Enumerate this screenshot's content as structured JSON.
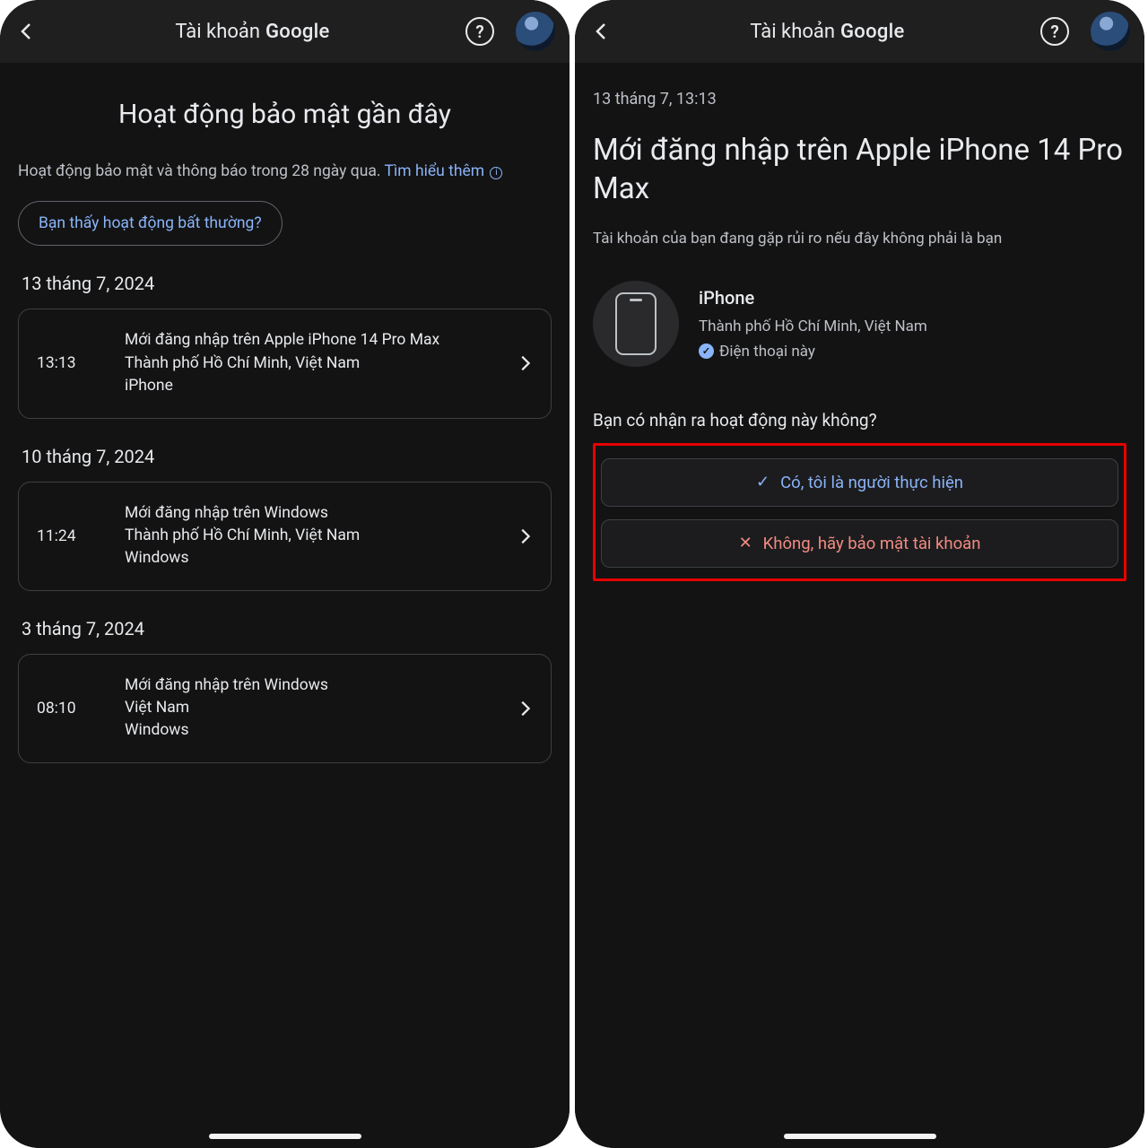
{
  "header": {
    "title_prefix": "Tài khoản",
    "brand": "Google",
    "help_glyph": "?"
  },
  "left": {
    "page_title": "Hoạt động bảo mật gần đây",
    "intro_text": "Hoạt động bảo mật và thông báo trong 28 ngày qua. ",
    "learn_more": "Tìm hiểu thêm",
    "unusual_btn": "Bạn thấy hoạt động bất thường?",
    "groups": [
      {
        "date": "13 tháng 7, 2024",
        "item": {
          "time": "13:13",
          "line1": "Mới đăng nhập trên Apple iPhone 14 Pro Max",
          "line2": "Thành phố Hồ Chí Minh, Việt Nam",
          "line3": "iPhone"
        }
      },
      {
        "date": "10 tháng 7, 2024",
        "item": {
          "time": "11:24",
          "line1": "Mới đăng nhập trên Windows",
          "line2": "Thành phố Hồ Chí Minh, Việt Nam",
          "line3": "Windows"
        }
      },
      {
        "date": "3 tháng 7, 2024",
        "item": {
          "time": "08:10",
          "line1": "Mới đăng nhập trên Windows",
          "line2": "Việt Nam",
          "line3": "Windows"
        }
      }
    ]
  },
  "right": {
    "timestamp": "13 tháng 7, 13:13",
    "title": "Mới đăng nhập trên Apple iPhone 14 Pro Max",
    "warning": "Tài khoản của bạn đang gặp rủi ro nếu đây không phải là bạn",
    "device": {
      "name": "iPhone",
      "location": "Thành phố Hồ Chí Minh, Việt Nam",
      "this_device": "Điện thoại này"
    },
    "prompt": "Bạn có nhận ra hoạt động này không?",
    "yes_label": "Có, tôi là người thực hiện",
    "no_label": "Không, hãy bảo mật tài khoản"
  }
}
